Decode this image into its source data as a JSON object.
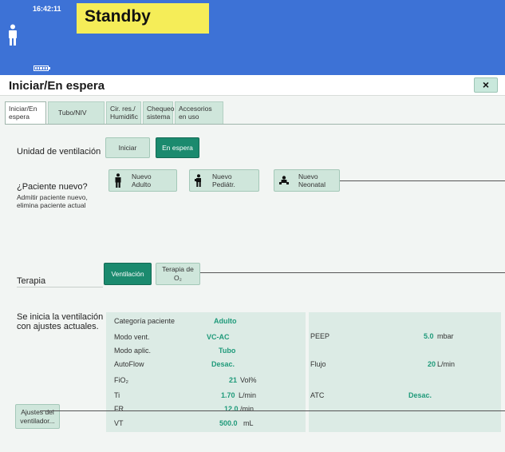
{
  "status": {
    "time": "16:42:11",
    "mode": "Standby"
  },
  "window": {
    "title": "Iniciar/En espera",
    "close_label": "×"
  },
  "tabs": [
    {
      "l1": "Iniciar/En",
      "l2": "espera"
    },
    {
      "l1": "Tubo/NIV",
      "l2": ""
    },
    {
      "l1": "Cir. res./",
      "l2": "Humidific"
    },
    {
      "l1": "Chequeo",
      "l2": "sistema"
    },
    {
      "l1": "Accesorios",
      "l2": "en uso"
    }
  ],
  "unit_section": {
    "label": "Unidad de ventilación",
    "start": "Iniciar",
    "standby": "En espera"
  },
  "patient_section": {
    "label": "¿Paciente nuevo?",
    "note1": "Admitir paciente nuevo,",
    "note2": "elimina paciente actual",
    "adult": {
      "l1": "Nuevo",
      "l2": "Adulto"
    },
    "pediatric": {
      "l1": "Nuevo",
      "l2": "Pediátr."
    },
    "neonatal": {
      "l1": "Nuevo",
      "l2": "Neonatal"
    }
  },
  "therapy_section": {
    "label": "Terapia",
    "ventilation": "Ventilación",
    "o2_l1": "Terapia de",
    "o2_l2": "O₂"
  },
  "settings": {
    "note1": "Se inicia la ventilación",
    "note2": "con ajustes actuales.",
    "button_l1": "Ajustes del",
    "button_l2": "ventilador...",
    "left": [
      {
        "name": "Categoría paciente",
        "value": "Adulto",
        "unit": ""
      },
      {
        "name": "Modo vent.",
        "value": "VC-AC",
        "unit": ""
      },
      {
        "name": "Modo aplic.",
        "value": "Tubo",
        "unit": ""
      },
      {
        "name": "AutoFlow",
        "value": "Desac.",
        "unit": ""
      },
      {
        "name": "FiO₂",
        "value": "21",
        "unit": "Vol%"
      },
      {
        "name": "Ti",
        "value": "1.70",
        "unit": "L/min"
      },
      {
        "name": "FR",
        "value": "12.0",
        "unit": "/min"
      },
      {
        "name": "VT",
        "value": "500.0",
        "unit": "mL"
      }
    ],
    "right": [
      {
        "name": "PEEP",
        "value": "5.0",
        "unit": "mbar"
      },
      {
        "name": "Flujo",
        "value": "20",
        "unit": "L/min"
      },
      {
        "name": "ATC",
        "value": "Desac.",
        "unit": ""
      }
    ]
  },
  "colors": {
    "header": "#3d72d6",
    "standby_bg": "#f5ed58",
    "selected": "#1b8a6e",
    "button": "#cfe6db",
    "value": "#1f9a7a"
  }
}
